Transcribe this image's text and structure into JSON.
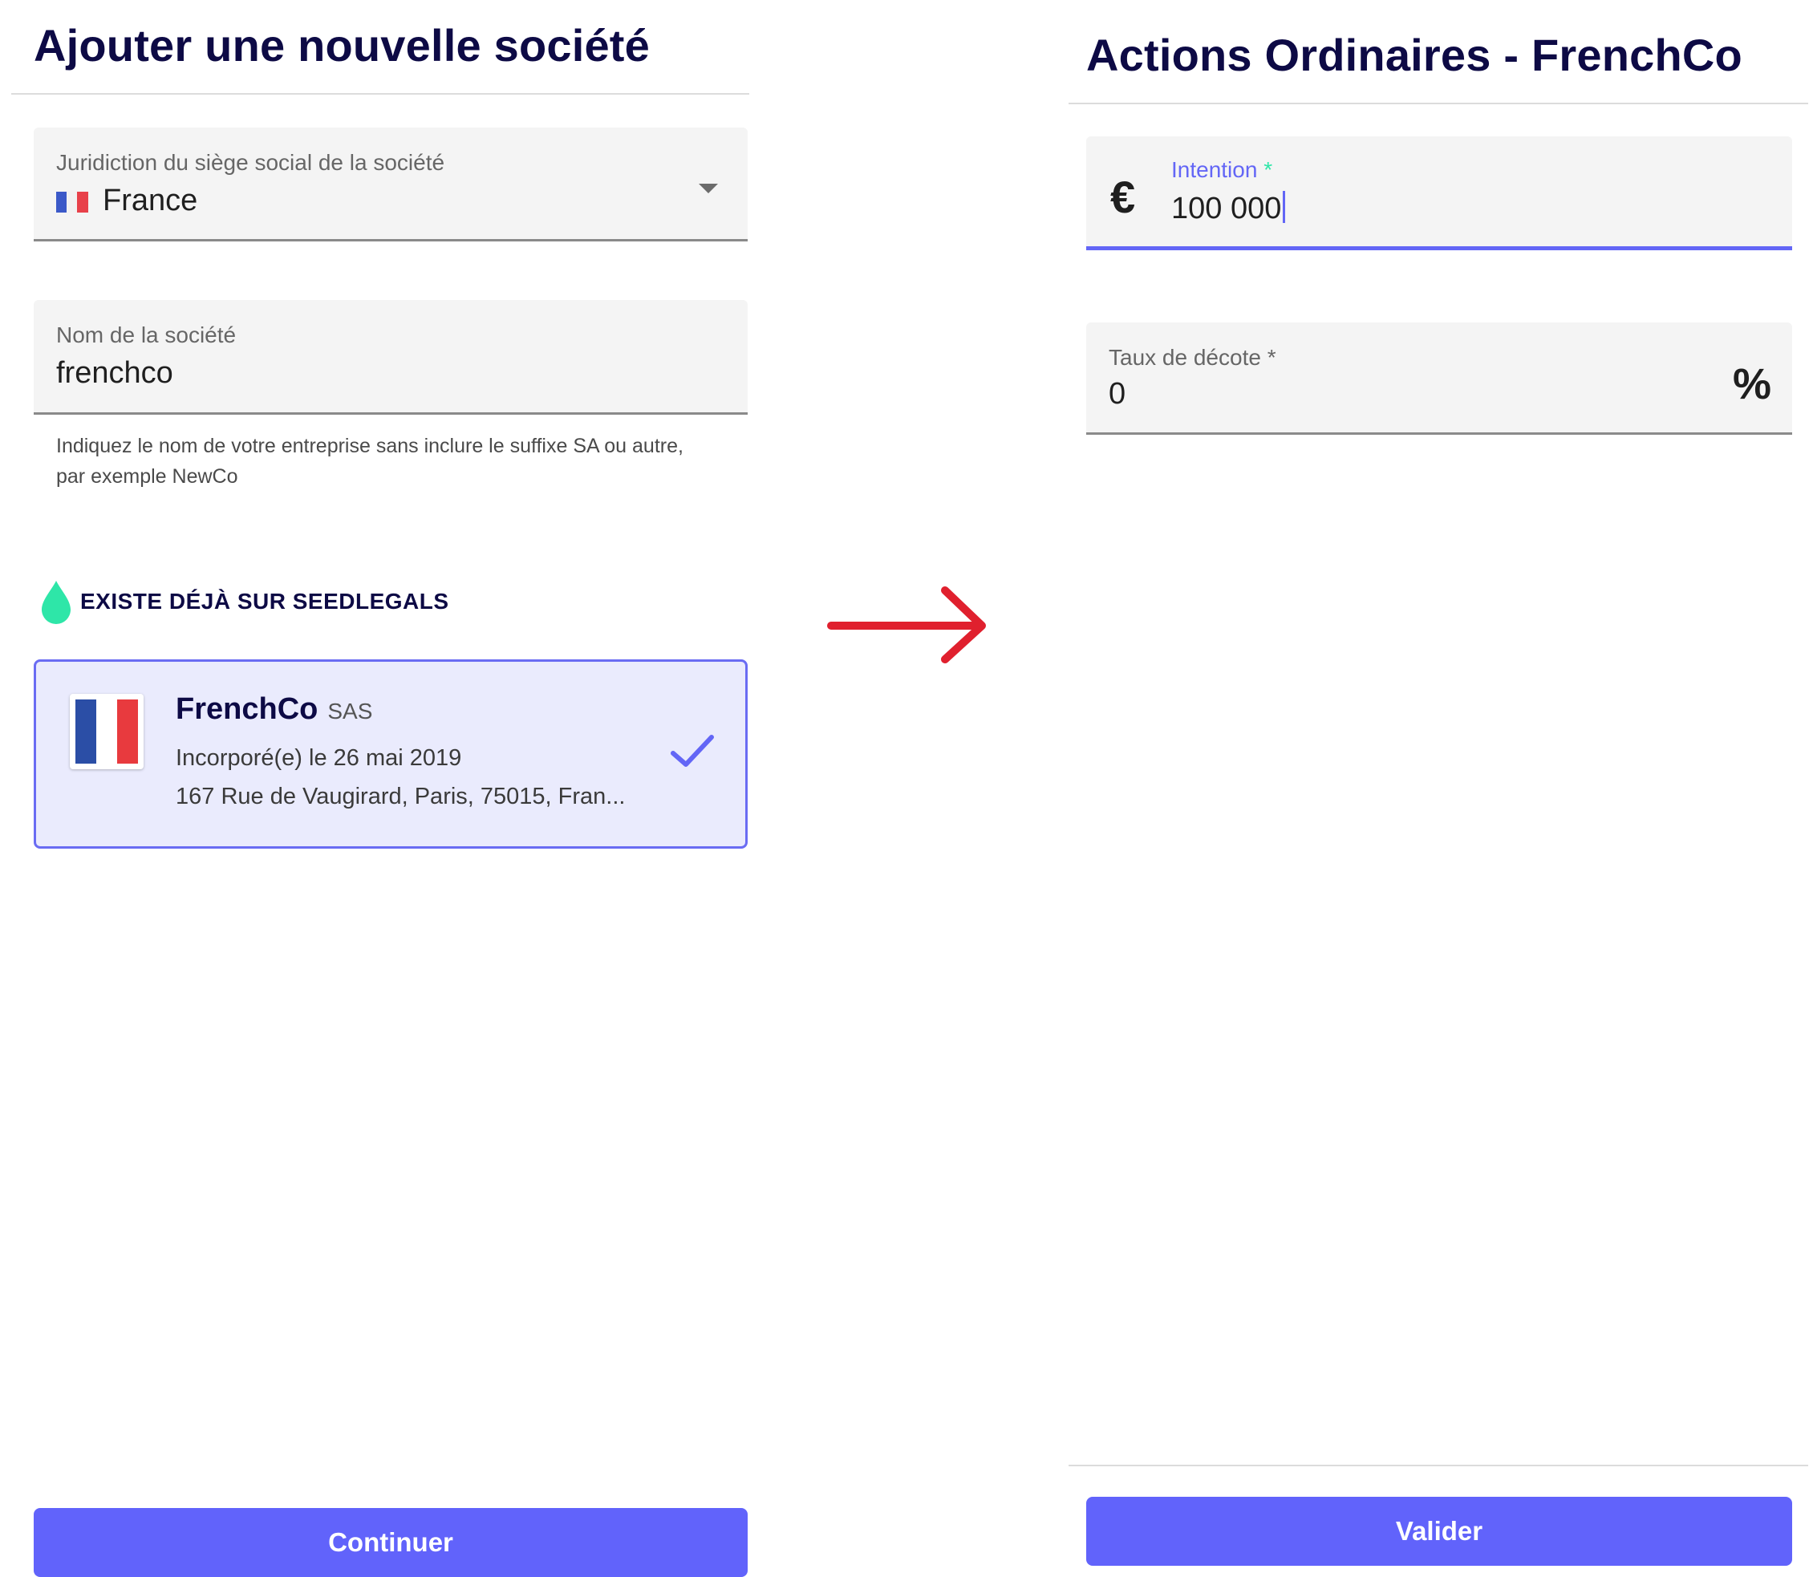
{
  "left_panel": {
    "title": "Ajouter une nouvelle société",
    "jurisdiction_field": {
      "label": "Juridiction du siège social de la société",
      "value": "France"
    },
    "company_name_field": {
      "label": "Nom de la société",
      "value": "frenchco",
      "helper": "Indiquez le nom de votre entreprise sans inclure le suffixe SA ou autre, par exemple NewCo"
    },
    "existing_section": {
      "heading": "EXISTE DÉJÀ SUR SEEDLEGALS"
    },
    "company_card": {
      "name": "FrenchCo",
      "type": "SAS",
      "incorporated": "Incorporé(e) le 26 mai 2019",
      "address": "167 Rue de Vaugirard, Paris, 75015, Fran..."
    },
    "continue_label": "Continuer"
  },
  "right_panel": {
    "title": "Actions Ordinaires - FrenchCo",
    "intention_field": {
      "label": "Intention",
      "required_mark": "*",
      "currency_symbol": "€",
      "value": "100 000"
    },
    "discount_field": {
      "label": "Taux de décote *",
      "value": "0",
      "unit_symbol": "%"
    },
    "validate_label": "Valider"
  },
  "colors": {
    "title": "#0d0a45",
    "accent": "#6366f6",
    "button": "#6163fb",
    "arrow": "#e0202e",
    "seedlegals_drop": "#2ee6a8",
    "card_background": "#eaebfd"
  },
  "icons": {
    "dropdown": "caret-down-icon",
    "flag": "france-flag-icon",
    "drop": "seedlegals-drop-icon",
    "check": "check-icon",
    "arrow": "arrow-right-icon",
    "euro": "euro-icon",
    "percent": "percent-icon"
  }
}
